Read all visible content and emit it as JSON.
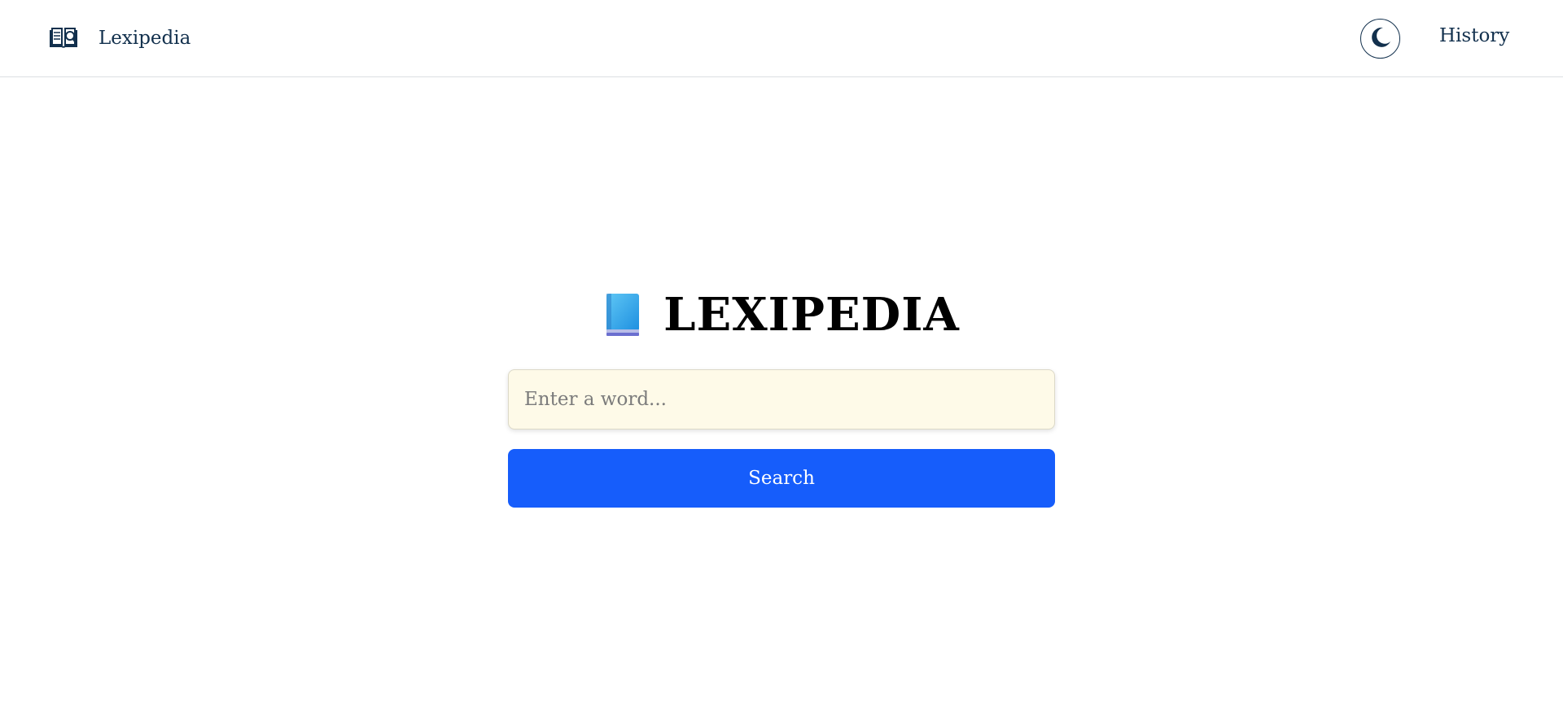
{
  "navbar": {
    "brand_label": "Lexipedia",
    "brand_icon": "open-book-magnifier-icon",
    "theme_toggle_icon": "moon-icon",
    "history_label": "History"
  },
  "hero": {
    "icon": "blue-book-icon",
    "title": "LEXIPEDIA"
  },
  "search": {
    "placeholder": "Enter a word...",
    "value": "",
    "button_label": "Search"
  },
  "colors": {
    "accent": "#165dfb",
    "text_dark": "#12304d",
    "input_bg": "#fefae8",
    "border": "#dcdfe3"
  }
}
